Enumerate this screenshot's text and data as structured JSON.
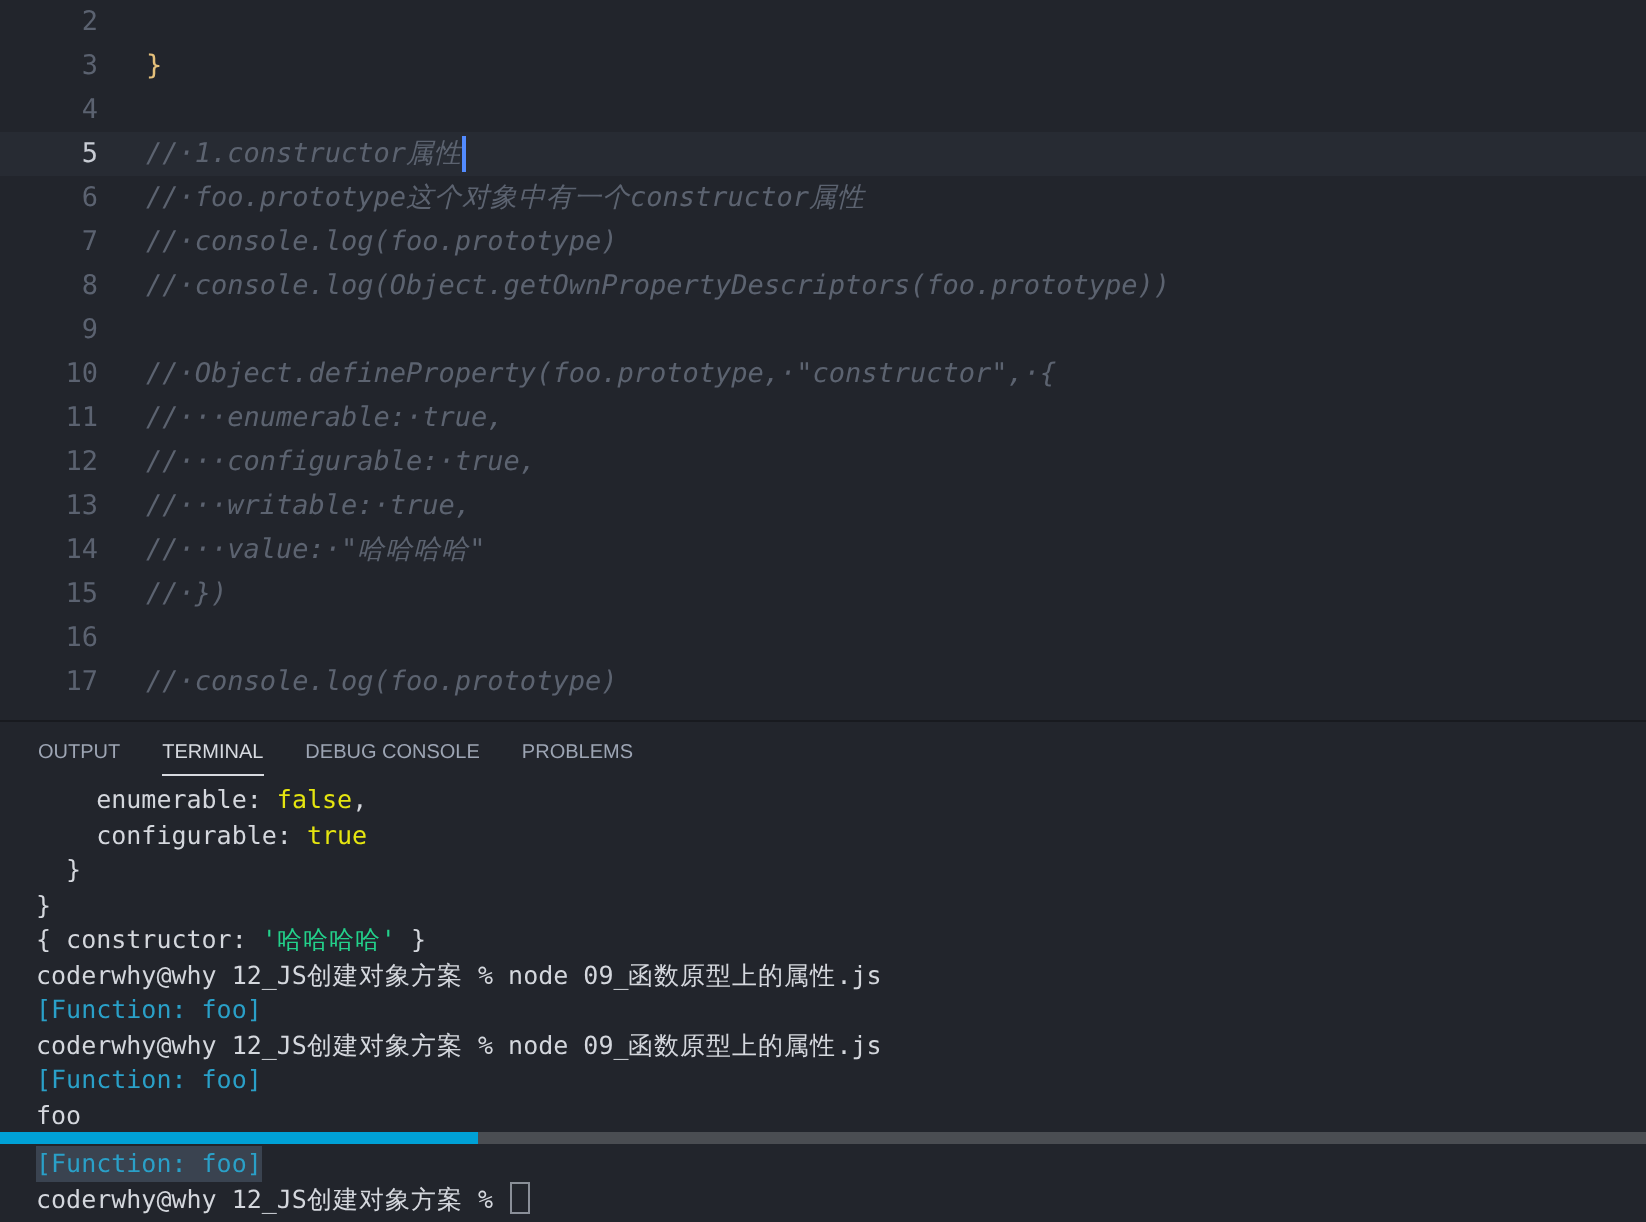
{
  "editor": {
    "lines": [
      {
        "number": "2",
        "active": false
      },
      {
        "number": "3",
        "active": false,
        "kind": "code",
        "text": "}"
      },
      {
        "number": "4",
        "active": false
      },
      {
        "number": "5",
        "active": true,
        "kind": "comment",
        "text": "//·1.constructor属性"
      },
      {
        "number": "6",
        "active": false,
        "kind": "comment",
        "text": "//·foo.prototype这个对象中有一个constructor属性"
      },
      {
        "number": "7",
        "active": false,
        "kind": "comment",
        "text": "//·console.log(foo.prototype)"
      },
      {
        "number": "8",
        "active": false,
        "kind": "comment",
        "text": "//·console.log(Object.getOwnPropertyDescriptors(foo.prototype))"
      },
      {
        "number": "9",
        "active": false
      },
      {
        "number": "10",
        "active": false,
        "kind": "comment",
        "text": "//·Object.defineProperty(foo.prototype,·\"constructor\",·{"
      },
      {
        "number": "11",
        "active": false,
        "kind": "comment",
        "text": "//···enumerable:·true,"
      },
      {
        "number": "12",
        "active": false,
        "kind": "comment",
        "text": "//···configurable:·true,"
      },
      {
        "number": "13",
        "active": false,
        "kind": "comment",
        "text": "//···writable:·true,"
      },
      {
        "number": "14",
        "active": false,
        "kind": "comment",
        "text": "//···value:·\"哈哈哈哈\""
      },
      {
        "number": "15",
        "active": false,
        "kind": "comment",
        "text": "//·})"
      },
      {
        "number": "16",
        "active": false
      },
      {
        "number": "17",
        "active": false,
        "kind": "comment",
        "text": "//·console.log(foo.prototype)"
      }
    ]
  },
  "panel": {
    "tabs": [
      {
        "label": "OUTPUT",
        "selected": false
      },
      {
        "label": "TERMINAL",
        "selected": true
      },
      {
        "label": "DEBUG CONSOLE",
        "selected": false
      },
      {
        "label": "PROBLEMS",
        "selected": false
      }
    ],
    "terminal": [
      {
        "selected": false,
        "segments": [
          {
            "kind": "plain",
            "text": "    enumerable: "
          },
          {
            "kind": "literal",
            "text": "false"
          },
          {
            "kind": "plain",
            "text": ","
          }
        ]
      },
      {
        "selected": false,
        "segments": [
          {
            "kind": "plain",
            "text": "    configurable: "
          },
          {
            "kind": "literal",
            "text": "true"
          }
        ]
      },
      {
        "selected": false,
        "segments": [
          {
            "kind": "plain",
            "text": "  }"
          }
        ]
      },
      {
        "selected": false,
        "segments": [
          {
            "kind": "plain",
            "text": "}"
          }
        ]
      },
      {
        "selected": false,
        "segments": [
          {
            "kind": "plain",
            "text": "{ constructor: "
          },
          {
            "kind": "string",
            "text": "'哈哈哈哈'"
          },
          {
            "kind": "plain",
            "text": " }"
          }
        ]
      },
      {
        "selected": false,
        "segments": [
          {
            "kind": "plain",
            "text": "coderwhy@why 12_JS创建对象方案 % node 09_函数原型上的属性.js"
          }
        ]
      },
      {
        "selected": false,
        "segments": [
          {
            "kind": "function",
            "text": "[Function: foo]"
          }
        ]
      },
      {
        "selected": false,
        "segments": [
          {
            "kind": "plain",
            "text": "coderwhy@why 12_JS创建对象方案 % node 09_函数原型上的属性.js"
          }
        ]
      },
      {
        "selected": false,
        "segments": [
          {
            "kind": "function",
            "text": "[Function: foo]"
          }
        ]
      },
      {
        "selected": false,
        "segments": [
          {
            "kind": "plain",
            "text": "foo"
          }
        ]
      },
      {
        "selected": true,
        "segments": [
          {
            "kind": "function",
            "text": "[Function: foo]"
          }
        ]
      }
    ],
    "prompt": {
      "text": "coderwhy@why 12_JS创建对象方案 %",
      "cursor": true
    }
  },
  "video_progress": {
    "level": 0.29
  }
}
